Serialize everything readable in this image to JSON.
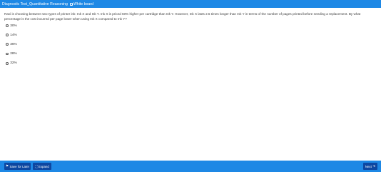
{
  "header": {
    "title": "Diagnostic Test_Quantitative Reasoning",
    "whiteboard_label": "White board"
  },
  "question": {
    "text": "Ravi is choosing between two types of printer ink: Ink X and Ink Y. Ink X is priced 60% higher per cartridge than Ink Y. However, Ink X lasts 2.5 times longer than Ink Y in terms of the number of pages printed before needing a replacement. By what percentage is the cost incurred per page lower when using Ink X compared to Ink Y?"
  },
  "options": [
    {
      "label": "30%"
    },
    {
      "label": "14%"
    },
    {
      "label": "36%"
    },
    {
      "label": "28%"
    },
    {
      "label": "32%"
    }
  ],
  "footer": {
    "save_label": "Save for Later",
    "expand_label": "Expand",
    "next_label": "Next"
  },
  "icons": {
    "whiteboard": "whiteboard-icon",
    "save": "bookmark-icon",
    "expand": "expand-icon",
    "next": "arrow-right-icon"
  },
  "colors": {
    "bar": "#1e88e5",
    "button": "#0d47a1"
  }
}
